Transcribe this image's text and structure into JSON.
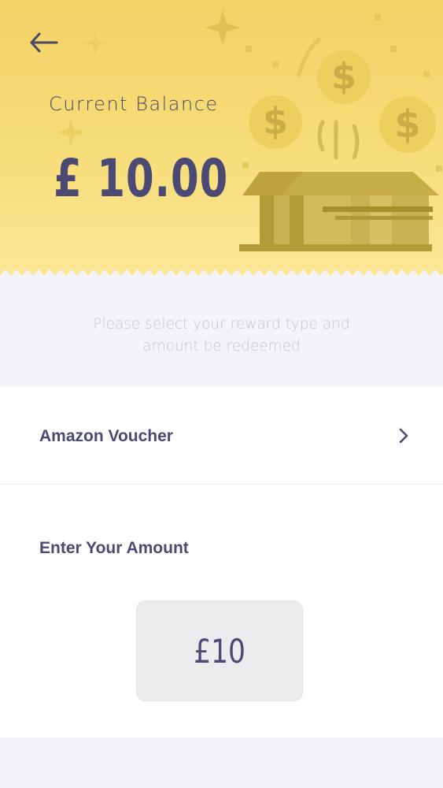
{
  "header": {
    "balance_label": "Current Balance",
    "balance_amount": "£ 10.00"
  },
  "instruction": {
    "line1": "Please select your reward type and",
    "line2": "amount be redeemed"
  },
  "reward": {
    "type_label": "Amazon Voucher"
  },
  "amount": {
    "heading": "Enter Your Amount",
    "value": "£10"
  },
  "icons": {
    "back": "back-arrow-icon",
    "chevron": "chevron-right-icon",
    "illustration": "treasure-box-illustration",
    "coin": "dollar-coin-icon",
    "sparkle": "sparkle-icon"
  },
  "colors": {
    "header_yellow": "#f5d870",
    "text_navy": "#4a4a75",
    "muted_text": "#c4c4cc",
    "illustration_olive": "#b9a137"
  }
}
